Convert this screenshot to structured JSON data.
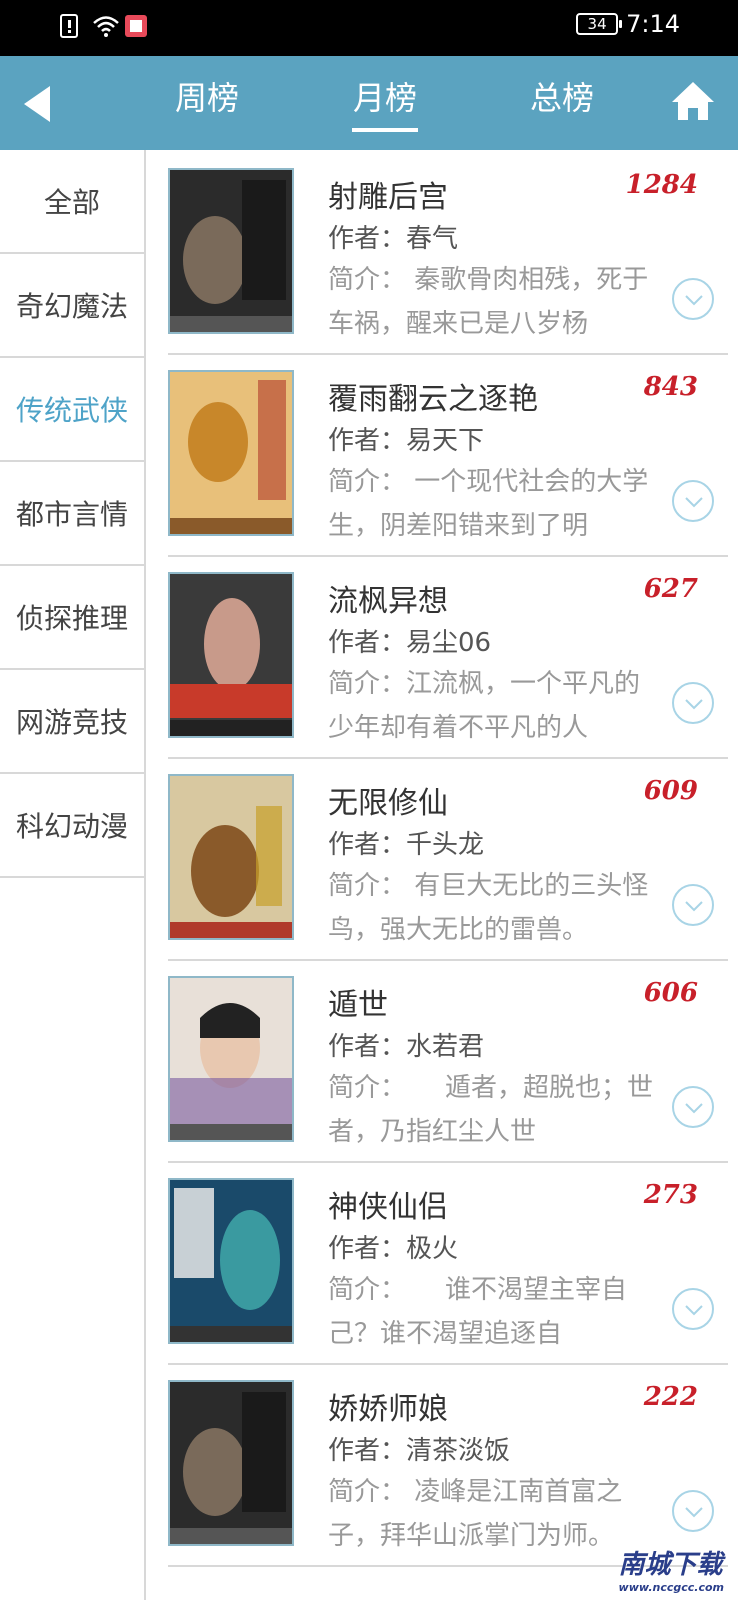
{
  "status_bar": {
    "battery": "34",
    "time": "7:14"
  },
  "nav": {
    "tabs": [
      "周榜",
      "月榜",
      "总榜"
    ],
    "active_tab": "月榜",
    "accent_color": "#5ba3c0"
  },
  "categories": [
    "全部",
    "奇幻魔法",
    "传统武侠",
    "都市言情",
    "侦探推理",
    "网游竞技",
    "科幻动漫"
  ],
  "active_category": "传统武侠",
  "books": [
    {
      "title": "射雕后宫",
      "count": "1284",
      "author": "作者：春气",
      "summary": "简介： 秦歌骨肉相残，死于车祸，醒来已是八岁杨",
      "cover_colors": [
        "#2b2b2b",
        "#7a6a5a"
      ]
    },
    {
      "title": "覆雨翻云之逐艳",
      "count": "843",
      "author": "作者：易天下",
      "summary": "简介： 一个现代社会的大学生，阴差阳错来到了明",
      "cover_colors": [
        "#c8872a",
        "#e8c07a"
      ]
    },
    {
      "title": "流枫异想",
      "count": "627",
      "author": "作者：易尘06",
      "summary": "简介：江流枫，一个平凡的少年却有着不平凡的人",
      "cover_colors": [
        "#3a3a3a",
        "#c83a2a"
      ]
    },
    {
      "title": "无限修仙",
      "count": "609",
      "author": "作者：千头龙",
      "summary": "简介： 有巨大无比的三头怪鸟，强大无比的雷兽。",
      "cover_colors": [
        "#d8c8a0",
        "#8a5a2a"
      ]
    },
    {
      "title": "遁世",
      "count": "606",
      "author": "作者：水若君",
      "summary": "简介：　　遁者，超脱也；世者，乃指红尘人世",
      "cover_colors": [
        "#e8e0d8",
        "#7a5aa0"
      ]
    },
    {
      "title": "神侠仙侣",
      "count": "273",
      "author": "作者：极火",
      "summary": "简介：　　谁不渴望主宰自己？谁不渴望追逐自",
      "cover_colors": [
        "#3a9aa0",
        "#1a4a6a"
      ]
    },
    {
      "title": "娇娇师娘",
      "count": "222",
      "author": "作者：清茶淡饭",
      "summary": "简介： 凌峰是江南首富之子，拜华山派掌门为师。",
      "cover_colors": [
        "#2b2b2b",
        "#7a6a5a"
      ]
    }
  ],
  "watermark": {
    "text": "南城下载",
    "sub": "www.nccgcc.com"
  }
}
